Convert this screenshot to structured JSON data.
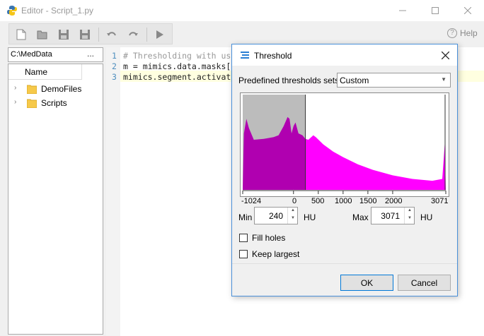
{
  "window": {
    "title": "Editor - Script_1.py"
  },
  "toolbar": {
    "help_label": "Help",
    "help_icon": "?"
  },
  "files": {
    "path": "C:\\MedData",
    "browse_label": "...",
    "column_header": "Name",
    "items": [
      {
        "label": "DemoFiles",
        "expander": "›"
      },
      {
        "label": "Scripts",
        "expander": "›"
      }
    ]
  },
  "editor": {
    "line_numbers": [
      "1",
      "2",
      "3"
    ],
    "lines": [
      "# Thresholding with us",
      "m = mimics.data.masks[",
      "mimics.segment.activat"
    ]
  },
  "dialog": {
    "title": "Threshold",
    "presets_label": "Predefined thresholds sets:",
    "presets_value": "Custom",
    "histogram": {
      "range": [
        -1024,
        3071
      ],
      "selected_min": 240,
      "selected_max": 3071,
      "tick_labels": [
        "-1024",
        "0",
        "500",
        "1000",
        "1500",
        "2000",
        "3071"
      ],
      "colors": {
        "selected": "#ff00ff",
        "selected_dark": "#b000b0",
        "outside": "#bcbcbc"
      }
    },
    "min_label": "Min",
    "min_value": "240",
    "max_label": "Max",
    "max_value": "3071",
    "unit": "HU",
    "fill_holes_label": "Fill holes",
    "keep_largest_label": "Keep largest",
    "ok_label": "OK",
    "cancel_label": "Cancel"
  }
}
